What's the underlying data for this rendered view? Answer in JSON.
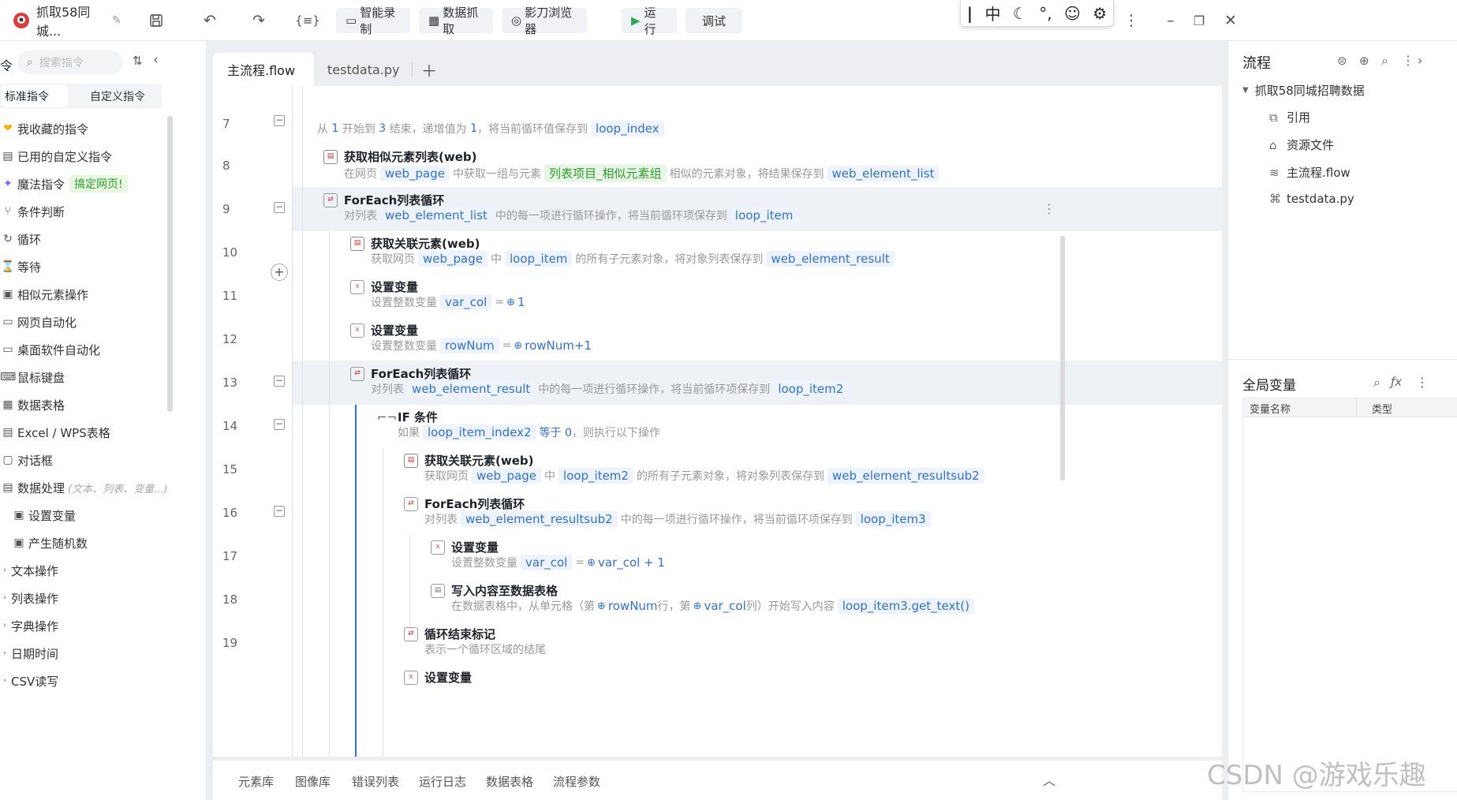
{
  "titlebar": {
    "app_title": "抓取58同城...",
    "buttons": [
      "智能录制",
      "数据抓取",
      "影刀浏览器",
      "运行",
      "调试"
    ],
    "ime": [
      "中"
    ]
  },
  "left": {
    "search_placeholder": "搜索指令",
    "tabs": [
      "标准指令",
      "自定义指令"
    ],
    "items": [
      "我收藏的指令",
      "已用的自定义指令",
      "魔法指令",
      "条件判断",
      "循环",
      "等待",
      "相似元素操作",
      "网页自动化",
      "桌面软件自动化",
      "鼠标键盘",
      "数据表格",
      "Excel / WPS表格",
      "对话框",
      "数据处理",
      "设置变量",
      "产生随机数",
      "文本操作",
      "列表操作",
      "字典操作",
      "日期时间",
      "CSV读写"
    ],
    "magic_badge": "搞定网页!",
    "data_proc_hint": "(文本、列表、变量...)"
  },
  "tabs": [
    "主流程.flow",
    "testdata.py"
  ],
  "editor": {
    "line_numbers": [
      "7",
      "8",
      "9",
      "10",
      "11",
      "12",
      "13",
      "14",
      "15",
      "16",
      "17",
      "18",
      "19"
    ],
    "row7": {
      "p1": "从",
      "n1": "1",
      "p2": "开始到",
      "n2": "3",
      "p3": "结束，递增值为",
      "n3": "1",
      "p4": "，将当前循环值保存到",
      "v": "loop_index"
    },
    "row8": {
      "title": "获取相似元素列表(web)",
      "p1": "在网页",
      "v1": "web_page",
      "p2": "中获取一组与元素",
      "v2": "列表项目_相似元素组",
      "p3": "相似的元素对象，将结果保存到",
      "v3": "web_element_list"
    },
    "row9": {
      "title": "ForEach列表循环",
      "p1": "对列表",
      "v1": "web_element_list",
      "p2": "中的每一项进行循环操作，将当前循环项保存到",
      "v2": "loop_item"
    },
    "row10": {
      "title": "获取关联元素(web)",
      "p1": "获取网页",
      "v1": "web_page",
      "p2": "中",
      "v2": "loop_item",
      "p3": "的所有子元素对象，将对象列表保存到",
      "v3": "web_element_result"
    },
    "row11": {
      "title": "设置变量",
      "p1": "设置整数变量",
      "v1": "var_col",
      "eq": "=",
      "val": "1"
    },
    "row12": {
      "title": "设置变量",
      "p1": "设置整数变量",
      "v1": "rowNum",
      "eq": "=",
      "val": "rowNum+1"
    },
    "row13": {
      "title": "ForEach列表循环",
      "p1": "对列表",
      "v1": "web_element_result",
      "p2": "中的每一项进行循环操作，将当前循环项保存到",
      "v2": "loop_item2"
    },
    "row14": {
      "title": "IF 条件",
      "p1": "如果",
      "v1": "loop_item_index2",
      "op": "等于 0",
      "p2": "，则执行以下操作"
    },
    "row15": {
      "title": "获取关联元素(web)",
      "p1": "获取网页",
      "v1": "web_page",
      "p2": "中",
      "v2": "loop_item2",
      "p3": "的所有子元素对象，将对象列表保存到",
      "v3": "web_element_resultsub2"
    },
    "row16": {
      "title": "ForEach列表循环",
      "p1": "对列表",
      "v1": "web_element_resultsub2",
      "p2": "中的每一项进行循环操作，将当前循环项保存到",
      "v2": "loop_item3"
    },
    "row17": {
      "title": "设置变量",
      "p1": "设置整数变量",
      "v1": "var_col",
      "eq": "=",
      "val": "var_col + 1"
    },
    "row18": {
      "title": "写入内容至数据表格",
      "p1": "在数据表格中，从单元格（第",
      "v1": "rowNum",
      "p2": "行，第",
      "v2": "var_col",
      "p3": "列）开始写入内容",
      "v3": "loop_item3.get_text()"
    },
    "row19": {
      "title": "循环结束标记",
      "desc": "表示一个循环区域的结尾"
    },
    "row20": {
      "title": "设置变量"
    }
  },
  "bottom_tabs": [
    "元素库",
    "图像库",
    "错误列表",
    "运行日志",
    "数据表格",
    "流程参数"
  ],
  "right": {
    "flow_title": "流程",
    "project": "抓取58同城招聘数据",
    "items": [
      "引用",
      "资源文件",
      "主流程.flow",
      "testdata.py"
    ],
    "globals_title": "全局变量",
    "col_name": "变量名称",
    "col_type": "类型"
  },
  "watermark": "CSDN @游戏乐趣"
}
